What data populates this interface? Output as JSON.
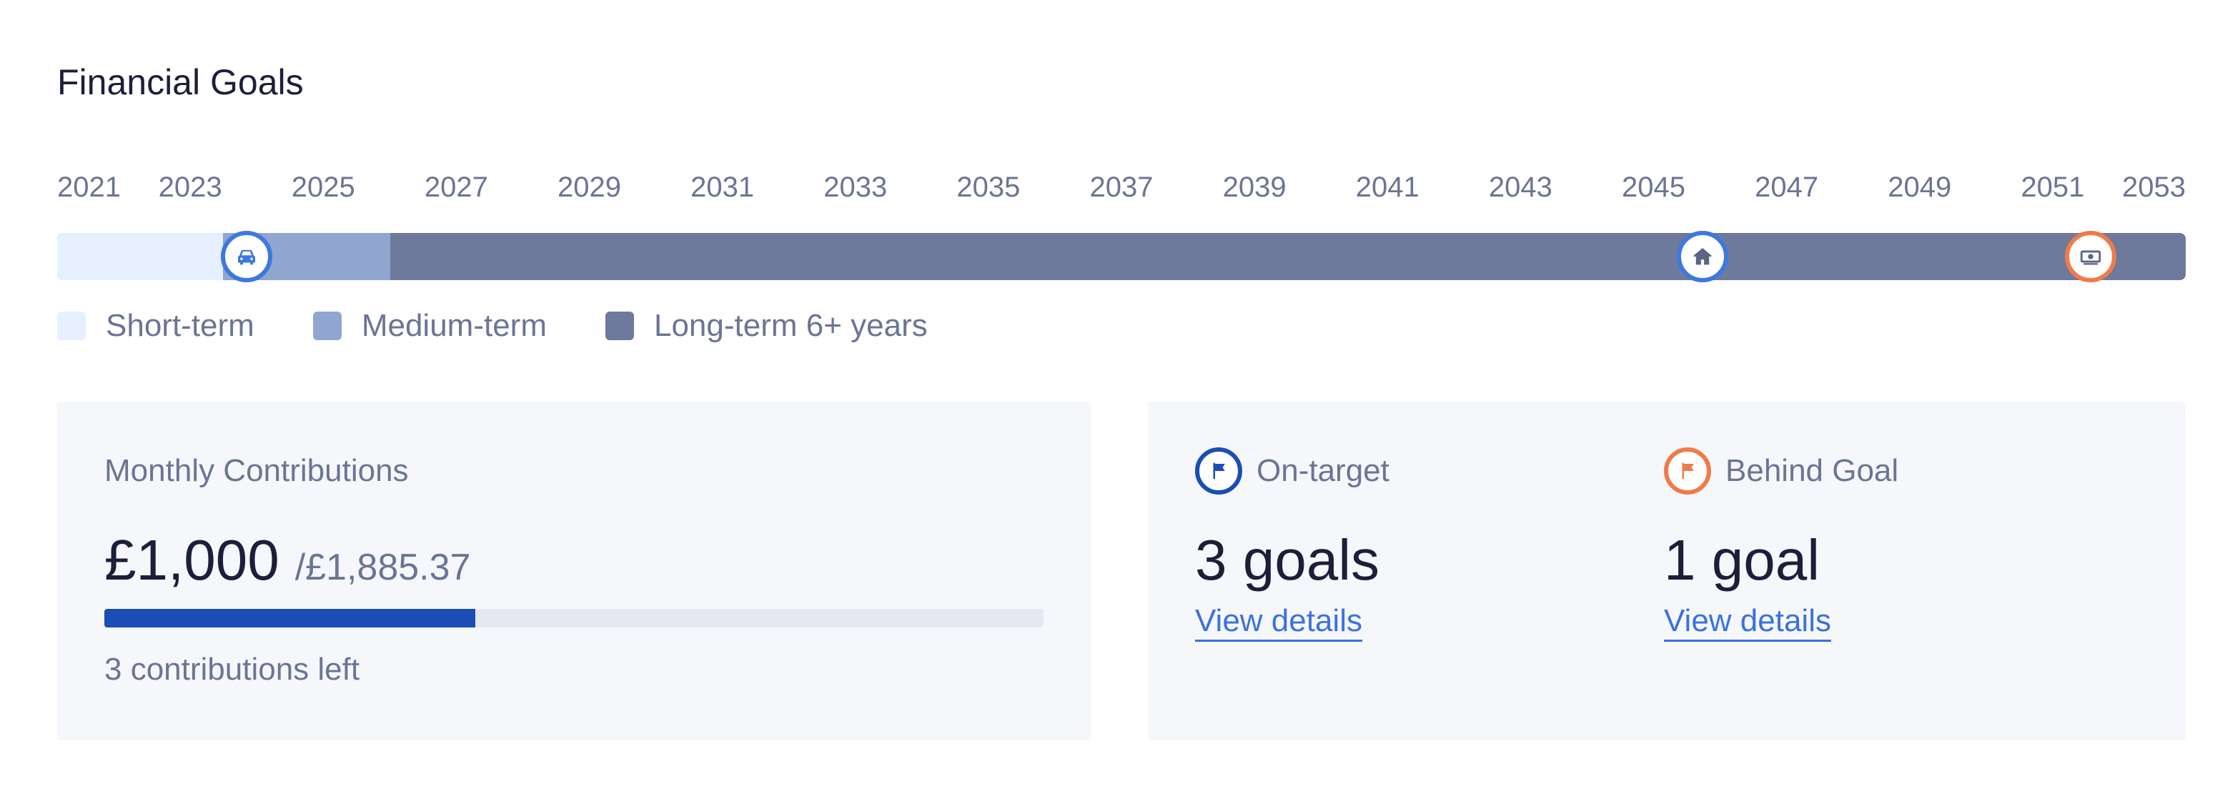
{
  "page": {
    "title": "Financial Goals"
  },
  "timeline": {
    "years": [
      "2021",
      "2023",
      "2025",
      "2027",
      "2029",
      "2031",
      "2033",
      "2035",
      "2037",
      "2039",
      "2041",
      "2043",
      "2045",
      "2047",
      "2049",
      "2051",
      "2053"
    ],
    "start_year": 2021,
    "end_year": 2053,
    "colors": {
      "short": "#e6f0ff",
      "medium": "#91a5d1",
      "long": "#6d7a9c"
    },
    "goals": [
      {
        "icon": "car-icon",
        "status": "on-target"
      },
      {
        "icon": "house-icon",
        "status": "on-target"
      },
      {
        "icon": "money-icon",
        "status": "behind"
      }
    ]
  },
  "legend": {
    "short": "Short-term",
    "medium": "Medium-term",
    "long": "Long-term 6+ years"
  },
  "contributions": {
    "heading": "Monthly Contributions",
    "amount": "£1,000",
    "total": "/£1,885.37",
    "progress_fraction": 0.395,
    "left_note": "3 contributions left"
  },
  "status": {
    "on_target": {
      "label": "On-target",
      "count": "3 goals",
      "link": "View details",
      "color": "#1a4db5"
    },
    "behind": {
      "label": "Behind Goal",
      "count": "1 goal",
      "link": "View details",
      "color": "#f07a4a"
    }
  }
}
